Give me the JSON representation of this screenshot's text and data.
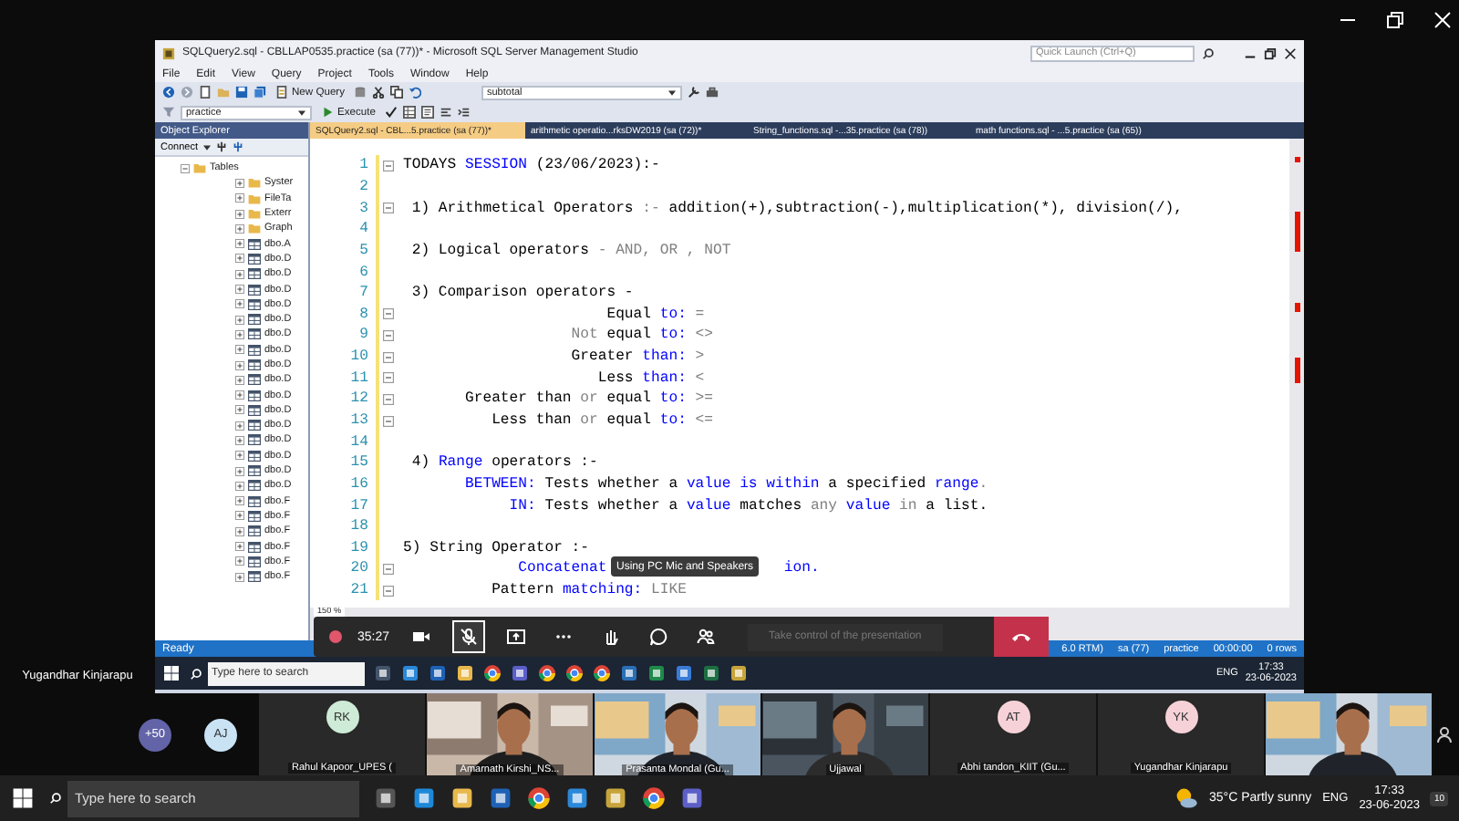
{
  "shared_screen": {
    "title": "SQLQuery2.sql - CBLLAP0535.practice (sa (77))* - Microsoft SQL Server Management Studio",
    "quick_launch": {
      "placeholder": "Quick Launch (Ctrl+Q)"
    },
    "menu": [
      "File",
      "Edit",
      "View",
      "Query",
      "Project",
      "Tools",
      "Window",
      "Help"
    ],
    "toolbar": {
      "new_query": "New Query",
      "find_box": "subtotal",
      "database": "practice",
      "execute": "Execute"
    },
    "object_explorer": {
      "title": "Object Explorer",
      "connect": "Connect",
      "tree": [
        {
          "label": "Tables",
          "expanded": true,
          "children": [
            {
              "label": "Syster",
              "kind": "folder",
              "expanded": false
            },
            {
              "label": "FileTa",
              "kind": "folder",
              "expanded": false
            },
            {
              "label": "Exterr",
              "kind": "folder",
              "expanded": false
            },
            {
              "label": "Graph",
              "kind": "folder",
              "expanded": false
            },
            {
              "label": "dbo.A",
              "kind": "table",
              "expanded": false
            },
            {
              "label": "dbo.D",
              "kind": "table",
              "expanded": false
            },
            {
              "label": "dbo.D",
              "kind": "table",
              "expanded": false
            },
            {
              "label": "dbo.D",
              "kind": "table",
              "expanded": false
            },
            {
              "label": "dbo.D",
              "kind": "table",
              "expanded": false
            },
            {
              "label": "dbo.D",
              "kind": "table",
              "expanded": false
            },
            {
              "label": "dbo.D",
              "kind": "table",
              "expanded": false
            },
            {
              "label": "dbo.D",
              "kind": "table",
              "expanded": false
            },
            {
              "label": "dbo.D",
              "kind": "table",
              "expanded": false
            },
            {
              "label": "dbo.D",
              "kind": "table",
              "expanded": false
            },
            {
              "label": "dbo.D",
              "kind": "table",
              "expanded": false
            },
            {
              "label": "dbo.D",
              "kind": "table",
              "expanded": false
            },
            {
              "label": "dbo.D",
              "kind": "table",
              "expanded": false
            },
            {
              "label": "dbo.D",
              "kind": "table",
              "expanded": false
            },
            {
              "label": "dbo.D",
              "kind": "table",
              "expanded": false
            },
            {
              "label": "dbo.D",
              "kind": "table",
              "expanded": false
            },
            {
              "label": "dbo.D",
              "kind": "table",
              "expanded": false
            },
            {
              "label": "dbo.F",
              "kind": "table",
              "expanded": false
            },
            {
              "label": "dbo.F",
              "kind": "table",
              "expanded": false
            },
            {
              "label": "dbo.F",
              "kind": "table",
              "expanded": false
            },
            {
              "label": "dbo.F",
              "kind": "table",
              "expanded": false
            },
            {
              "label": "dbo.F",
              "kind": "table",
              "expanded": false
            },
            {
              "label": "dbo.F",
              "kind": "table",
              "expanded": false
            }
          ]
        }
      ]
    },
    "tabs": [
      {
        "label": "SQLQuery2.sql - CBL...5.practice (sa (77))*",
        "selected": true
      },
      {
        "label": "arithmetic operatio...rksDW2019 (sa (72))*",
        "selected": false
      },
      {
        "label": "String_functions.sql -...35.practice (sa (78))",
        "selected": false
      },
      {
        "label": "math functions.sql - ...5.practice (sa (65))",
        "selected": false
      }
    ],
    "editor": {
      "lines": [
        {
          "number": "1",
          "fold": true,
          "segments": [
            {
              "text": "TODAYS ",
              "kind": "plain"
            },
            {
              "text": "SESSION",
              "kind": "keyword"
            },
            {
              "text": " (23/06/2023):-",
              "kind": "plain"
            }
          ]
        },
        {
          "number": "2",
          "fold": false
        },
        {
          "number": "3",
          "fold": true,
          "segments": [
            {
              "text": " 1) Arithmetical Operators ",
              "kind": "plain"
            },
            {
              "text": ":-",
              "kind": "operator"
            },
            {
              "text": " addition(+),subtraction(-),multiplication(*), division(/),",
              "kind": "plain"
            }
          ]
        },
        {
          "number": "4",
          "fold": false
        },
        {
          "number": "5",
          "fold": false,
          "segments": [
            {
              "text": " 2) Logical operators ",
              "kind": "plain"
            },
            {
              "text": "- AND, OR , NOT",
              "kind": "operator"
            }
          ]
        },
        {
          "number": "6",
          "fold": false
        },
        {
          "number": "7",
          "fold": false,
          "segments": [
            {
              "text": " 3) Comparison operators -",
              "kind": "plain"
            }
          ]
        },
        {
          "number": "8",
          "fold": true,
          "segments": [
            {
              "text": "                       Equal ",
              "kind": "plain"
            },
            {
              "text": "to:",
              "kind": "keyword"
            },
            {
              "text": " =",
              "kind": "operator"
            }
          ]
        },
        {
          "number": "9",
          "fold": true,
          "segments": [
            {
              "text": "                   Not",
              "kind": "operator"
            },
            {
              "text": " equal ",
              "kind": "plain"
            },
            {
              "text": "to:",
              "kind": "keyword"
            },
            {
              "text": " <>",
              "kind": "operator"
            }
          ]
        },
        {
          "number": "10",
          "fold": true,
          "segments": [
            {
              "text": "                   Greater ",
              "kind": "plain"
            },
            {
              "text": "than:",
              "kind": "keyword"
            },
            {
              "text": " >",
              "kind": "operator"
            }
          ]
        },
        {
          "number": "11",
          "fold": true,
          "segments": [
            {
              "text": "                      Less ",
              "kind": "plain"
            },
            {
              "text": "than:",
              "kind": "keyword"
            },
            {
              "text": " <",
              "kind": "operator"
            }
          ]
        },
        {
          "number": "12",
          "fold": true,
          "segments": [
            {
              "text": "       Greater than ",
              "kind": "plain"
            },
            {
              "text": "or",
              "kind": "operator"
            },
            {
              "text": " equal ",
              "kind": "plain"
            },
            {
              "text": "to:",
              "kind": "keyword"
            },
            {
              "text": " >=",
              "kind": "operator"
            }
          ]
        },
        {
          "number": "13",
          "fold": true,
          "segments": [
            {
              "text": "          Less than ",
              "kind": "plain"
            },
            {
              "text": "or",
              "kind": "operator"
            },
            {
              "text": " equal ",
              "kind": "plain"
            },
            {
              "text": "to:",
              "kind": "keyword"
            },
            {
              "text": " <=",
              "kind": "operator"
            }
          ]
        },
        {
          "number": "14",
          "fold": false
        },
        {
          "number": "15",
          "fold": false,
          "segments": [
            {
              "text": " 4) ",
              "kind": "plain"
            },
            {
              "text": "Range",
              "kind": "keyword"
            },
            {
              "text": " operators :-",
              "kind": "plain"
            }
          ]
        },
        {
          "number": "16",
          "fold": false,
          "segments": [
            {
              "text": "       BETWEEN:",
              "kind": "keyword"
            },
            {
              "text": " Tests whether a ",
              "kind": "plain"
            },
            {
              "text": "value is within",
              "kind": "keyword"
            },
            {
              "text": " a specified ",
              "kind": "plain"
            },
            {
              "text": "range",
              "kind": "keyword"
            },
            {
              "text": ".",
              "kind": "operator"
            }
          ]
        },
        {
          "number": "17",
          "fold": false,
          "segments": [
            {
              "text": "            IN:",
              "kind": "keyword"
            },
            {
              "text": " Tests whether a ",
              "kind": "plain"
            },
            {
              "text": "value",
              "kind": "keyword"
            },
            {
              "text": " matches ",
              "kind": "plain"
            },
            {
              "text": "any",
              "kind": "operator"
            },
            {
              "text": " value",
              "kind": "keyword"
            },
            {
              "text": " in",
              "kind": "operator"
            },
            {
              "text": " a list.",
              "kind": "plain"
            }
          ]
        },
        {
          "number": "18",
          "fold": false
        },
        {
          "number": "19",
          "fold": false,
          "segments": [
            {
              "text": "5) String Operator :-",
              "kind": "plain"
            }
          ]
        },
        {
          "number": "20",
          "fold": true,
          "segments": [
            {
              "text": "             Concatenat",
              "kind": "keyword"
            },
            {
              "text": "                    ion.",
              "kind": "keyword"
            }
          ]
        },
        {
          "number": "21",
          "fold": true,
          "segments": [
            {
              "text": "          Pattern ",
              "kind": "plain"
            },
            {
              "text": "matching:",
              "kind": "keyword"
            },
            {
              "text": " LIKE",
              "kind": "operator"
            }
          ]
        }
      ],
      "zoom": "150 %"
    },
    "status_bar": {
      "left": "Ready",
      "items": [
        "6.0 RTM)",
        "sa (77)",
        "practice",
        "00:00:00",
        "0 rows"
      ]
    },
    "taskbar": {
      "search": {
        "placeholder": "Type here to search"
      },
      "language": "ENG",
      "time": "17:33",
      "date": "23-06-2023"
    }
  },
  "toast": "Using PC Mic and Speakers",
  "meeting_controls": {
    "timer": "35:27",
    "mic_muted": true,
    "take_control": {
      "label": "Take control of the presentation",
      "disabled": true
    }
  },
  "presenter_name": "Yugandhar Kinjarapu",
  "participants": [
    {
      "kind": "overflow",
      "label": "+50"
    },
    {
      "kind": "avatar",
      "initials": "AJ",
      "color": "#c9e3f5"
    },
    {
      "kind": "avatar_tile",
      "initials": "RK",
      "color": "#cdebd6",
      "name": "Rahul Kapoor_UPES ("
    },
    {
      "kind": "video",
      "name": "Amarnath Kirshi_NS..."
    },
    {
      "kind": "video",
      "name": "Prasanta Mondal (Gu..."
    },
    {
      "kind": "video",
      "name": "Ujjawal"
    },
    {
      "kind": "avatar_tile",
      "initials": "AT",
      "color": "#f6d2d8",
      "name": "Abhi tandon_KIIT (Gu..."
    },
    {
      "kind": "avatar_tile",
      "initials": "YK",
      "color": "#f6d2d8",
      "name": "Yugandhar Kinjarapu"
    },
    {
      "kind": "video"
    }
  ],
  "taskbar": {
    "search": {
      "placeholder": "Type here to search"
    },
    "weather": "35°C  Partly sunny",
    "language": "ENG",
    "time": "17:33",
    "date": "23-06-2023",
    "notifications": "10"
  }
}
